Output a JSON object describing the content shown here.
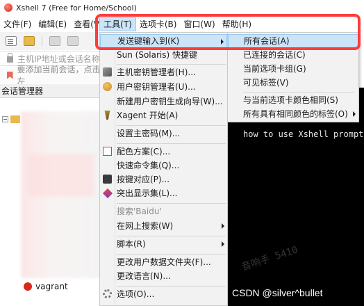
{
  "window": {
    "title": "Xshell 7 (Free for Home/School)"
  },
  "menubar": {
    "items": [
      "文件(F)",
      "编辑(E)",
      "查看(V",
      "工具(T)",
      "选项卡(B)",
      "窗口(W)",
      "帮助(H)"
    ],
    "active_index": 3
  },
  "toolbar": {
    "address_placeholder": "主机IP地址或会话名称",
    "hint_text": "要添加当前会话，点击左"
  },
  "session_manager": {
    "title": "会话管理器",
    "visible_item": "vagrant"
  },
  "tools_menu": {
    "items": {
      "send_keys": "发送键输入到(K)",
      "sun_keys": "Sun (Solaris) 快捷键",
      "host_key_mgr": "主机密钥管理者(H)...",
      "user_key_mgr": "用户密钥管理者(U)...",
      "new_key_wizard": "新建用户密钥生成向导(W)...",
      "xagent": "Xagent 开始(A)",
      "master_password": "设置主密码(M)...",
      "color_scheme": "配色方案(C)...",
      "quick_commands": "快速命令集(Q)...",
      "key_mapping": "按键对应(P)...",
      "highlight_sets": "突出显示集(L)...",
      "search_baidu": "搜索'Baidu'",
      "search_web": "在网上搜索(W)",
      "scripts": "脚本(R)",
      "change_data_folder": "更改用户数据文件夹(F)...",
      "change_language": "更改语言(N)...",
      "options": "选项(O)..."
    }
  },
  "send_keys_submenu": {
    "items": [
      "所有会话(A)",
      "已连接的会话(C)",
      "当前选项卡组(G)",
      "可见标签(V)",
      "与当前选项卡颜色相同(S)",
      "所有具有相同颜色的标签(O)"
    ],
    "highlighted_index": 0
  },
  "terminal": {
    "visible_line": "how to use Xshell prompt."
  },
  "watermarks": {
    "prompt_text": "音响手 5410",
    "csdn_credit": "CSDN @silver^bullet"
  },
  "colors": {
    "highlight_bg": "#cce4f7",
    "highlight_border": "#99c9ef",
    "annotation_red": "#ff3b3b",
    "terminal_bg": "#000000"
  }
}
